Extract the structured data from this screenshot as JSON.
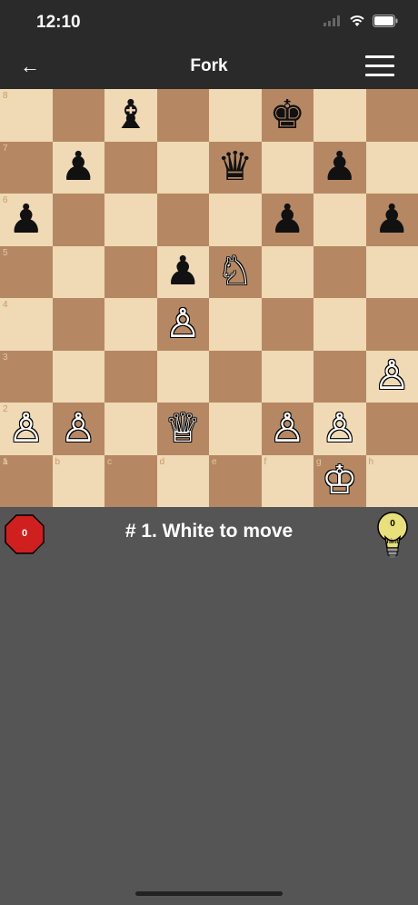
{
  "status": {
    "time": "12:10"
  },
  "nav": {
    "back_icon": "←",
    "title": "Fork"
  },
  "board": {
    "light_color": "#f0d9b5",
    "dark_color": "#b58863",
    "files": [
      "a",
      "b",
      "c",
      "d",
      "e",
      "f",
      "g",
      "h"
    ],
    "ranks": [
      "8",
      "7",
      "6",
      "5",
      "4",
      "3",
      "2",
      "1"
    ],
    "pieces": {
      "c8": "♝",
      "f8": "♚",
      "b7": "♟",
      "e7": "♛",
      "g7": "♟",
      "a6": "♟",
      "f6": "♟",
      "h6": "♟",
      "d5": "♟",
      "e5": "♘",
      "d4": "♙",
      "h3": "♙",
      "a2": "♙",
      "b2": "♙",
      "d2": "♕",
      "f2": "♙",
      "g2": "♙",
      "g1": "♔"
    }
  },
  "info": {
    "mistakes_count": "0",
    "move_text": "# 1. White to move",
    "hint_count": "0",
    "hint_label": "hint"
  },
  "colors": {
    "stop": "#d01f1f",
    "hint": "#e8e07a",
    "background": "#555555",
    "bar": "#2a2a2a"
  }
}
